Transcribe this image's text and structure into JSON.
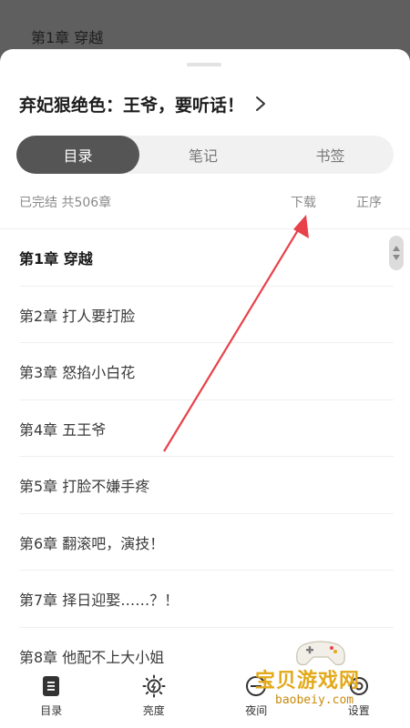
{
  "reader": {
    "chapter_title": "第1章 穿越"
  },
  "book": {
    "title": "弃妃狠绝色：王爷，要听话！"
  },
  "tabs": [
    {
      "label": "目录",
      "active": true
    },
    {
      "label": "笔记",
      "active": false
    },
    {
      "label": "书签",
      "active": false
    }
  ],
  "meta": {
    "status": "已完结 共506章",
    "download": "下载",
    "order": "正序"
  },
  "chapters": [
    "第1章 穿越",
    "第2章 打人要打脸",
    "第3章 怒掐小白花",
    "第4章 五王爷",
    "第5章 打脸不嫌手疼",
    "第6章 翻滚吧，演技！",
    "第7章 择日迎娶……？！",
    "第8章 他配不上大小姐"
  ],
  "bottom_nav": [
    {
      "label": "目录",
      "icon": "catalog-icon"
    },
    {
      "label": "亮度",
      "icon": "brightness-icon"
    },
    {
      "label": "夜间",
      "icon": "night-mode-icon"
    },
    {
      "label": "设置",
      "icon": "settings-icon"
    }
  ],
  "watermark": {
    "text": "宝贝游戏网",
    "domain": "baobeiy.com"
  },
  "colors": {
    "active_tab": "#555555",
    "annotation_arrow": "#e8414a",
    "watermark": "#e3a91a"
  }
}
